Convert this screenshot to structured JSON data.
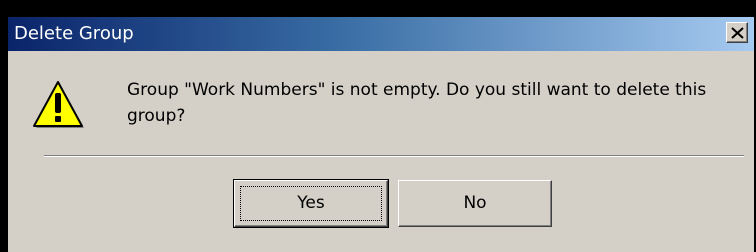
{
  "window": {
    "title": "Delete Group",
    "close_icon": "close-icon"
  },
  "message": {
    "icon": "warning-icon",
    "text": "Group \"Work Numbers\" is not empty. Do you still want to delete this group?"
  },
  "buttons": {
    "yes_label": "Yes",
    "no_label": "No"
  },
  "colors": {
    "titlebar_start": "#0a246a",
    "titlebar_end": "#a6caf0",
    "dialog_face": "#d4d0c8"
  }
}
